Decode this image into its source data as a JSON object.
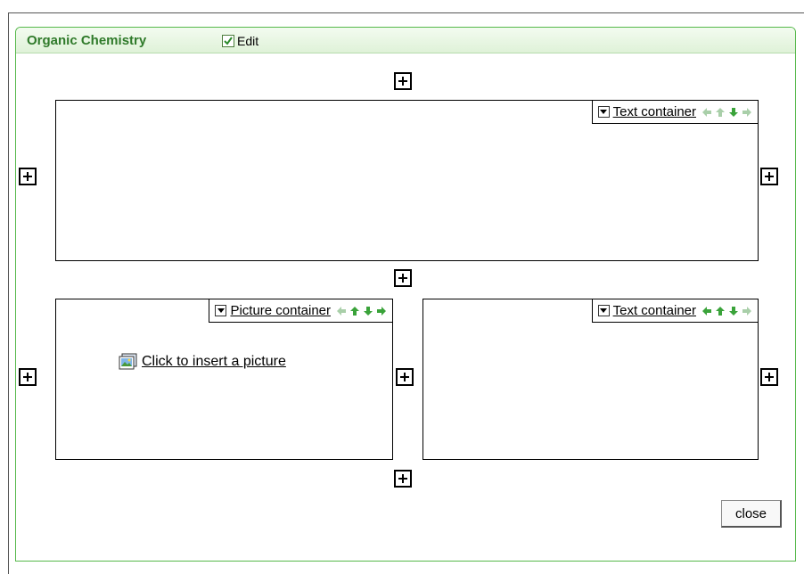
{
  "panel": {
    "title": "Organic Chemistry",
    "edit_label": "Edit",
    "edit_checked": true
  },
  "containers": [
    {
      "label": "Text container",
      "arrows": {
        "left": "disabled",
        "up": "disabled",
        "down": "enabled",
        "right": "disabled"
      }
    },
    {
      "label": "Picture container",
      "arrows": {
        "left": "disabled",
        "up": "enabled",
        "down": "enabled",
        "right": "enabled"
      },
      "insert_label": "Click to insert a picture"
    },
    {
      "label": "Text container",
      "arrows": {
        "left": "enabled",
        "up": "enabled",
        "down": "enabled",
        "right": "disabled"
      }
    }
  ],
  "close_label": "close",
  "colors": {
    "accent": "#2f7a2a",
    "border_green": "#55b84a",
    "arrow_enabled": "#3aa33a",
    "arrow_disabled": "#a9cfa9"
  }
}
